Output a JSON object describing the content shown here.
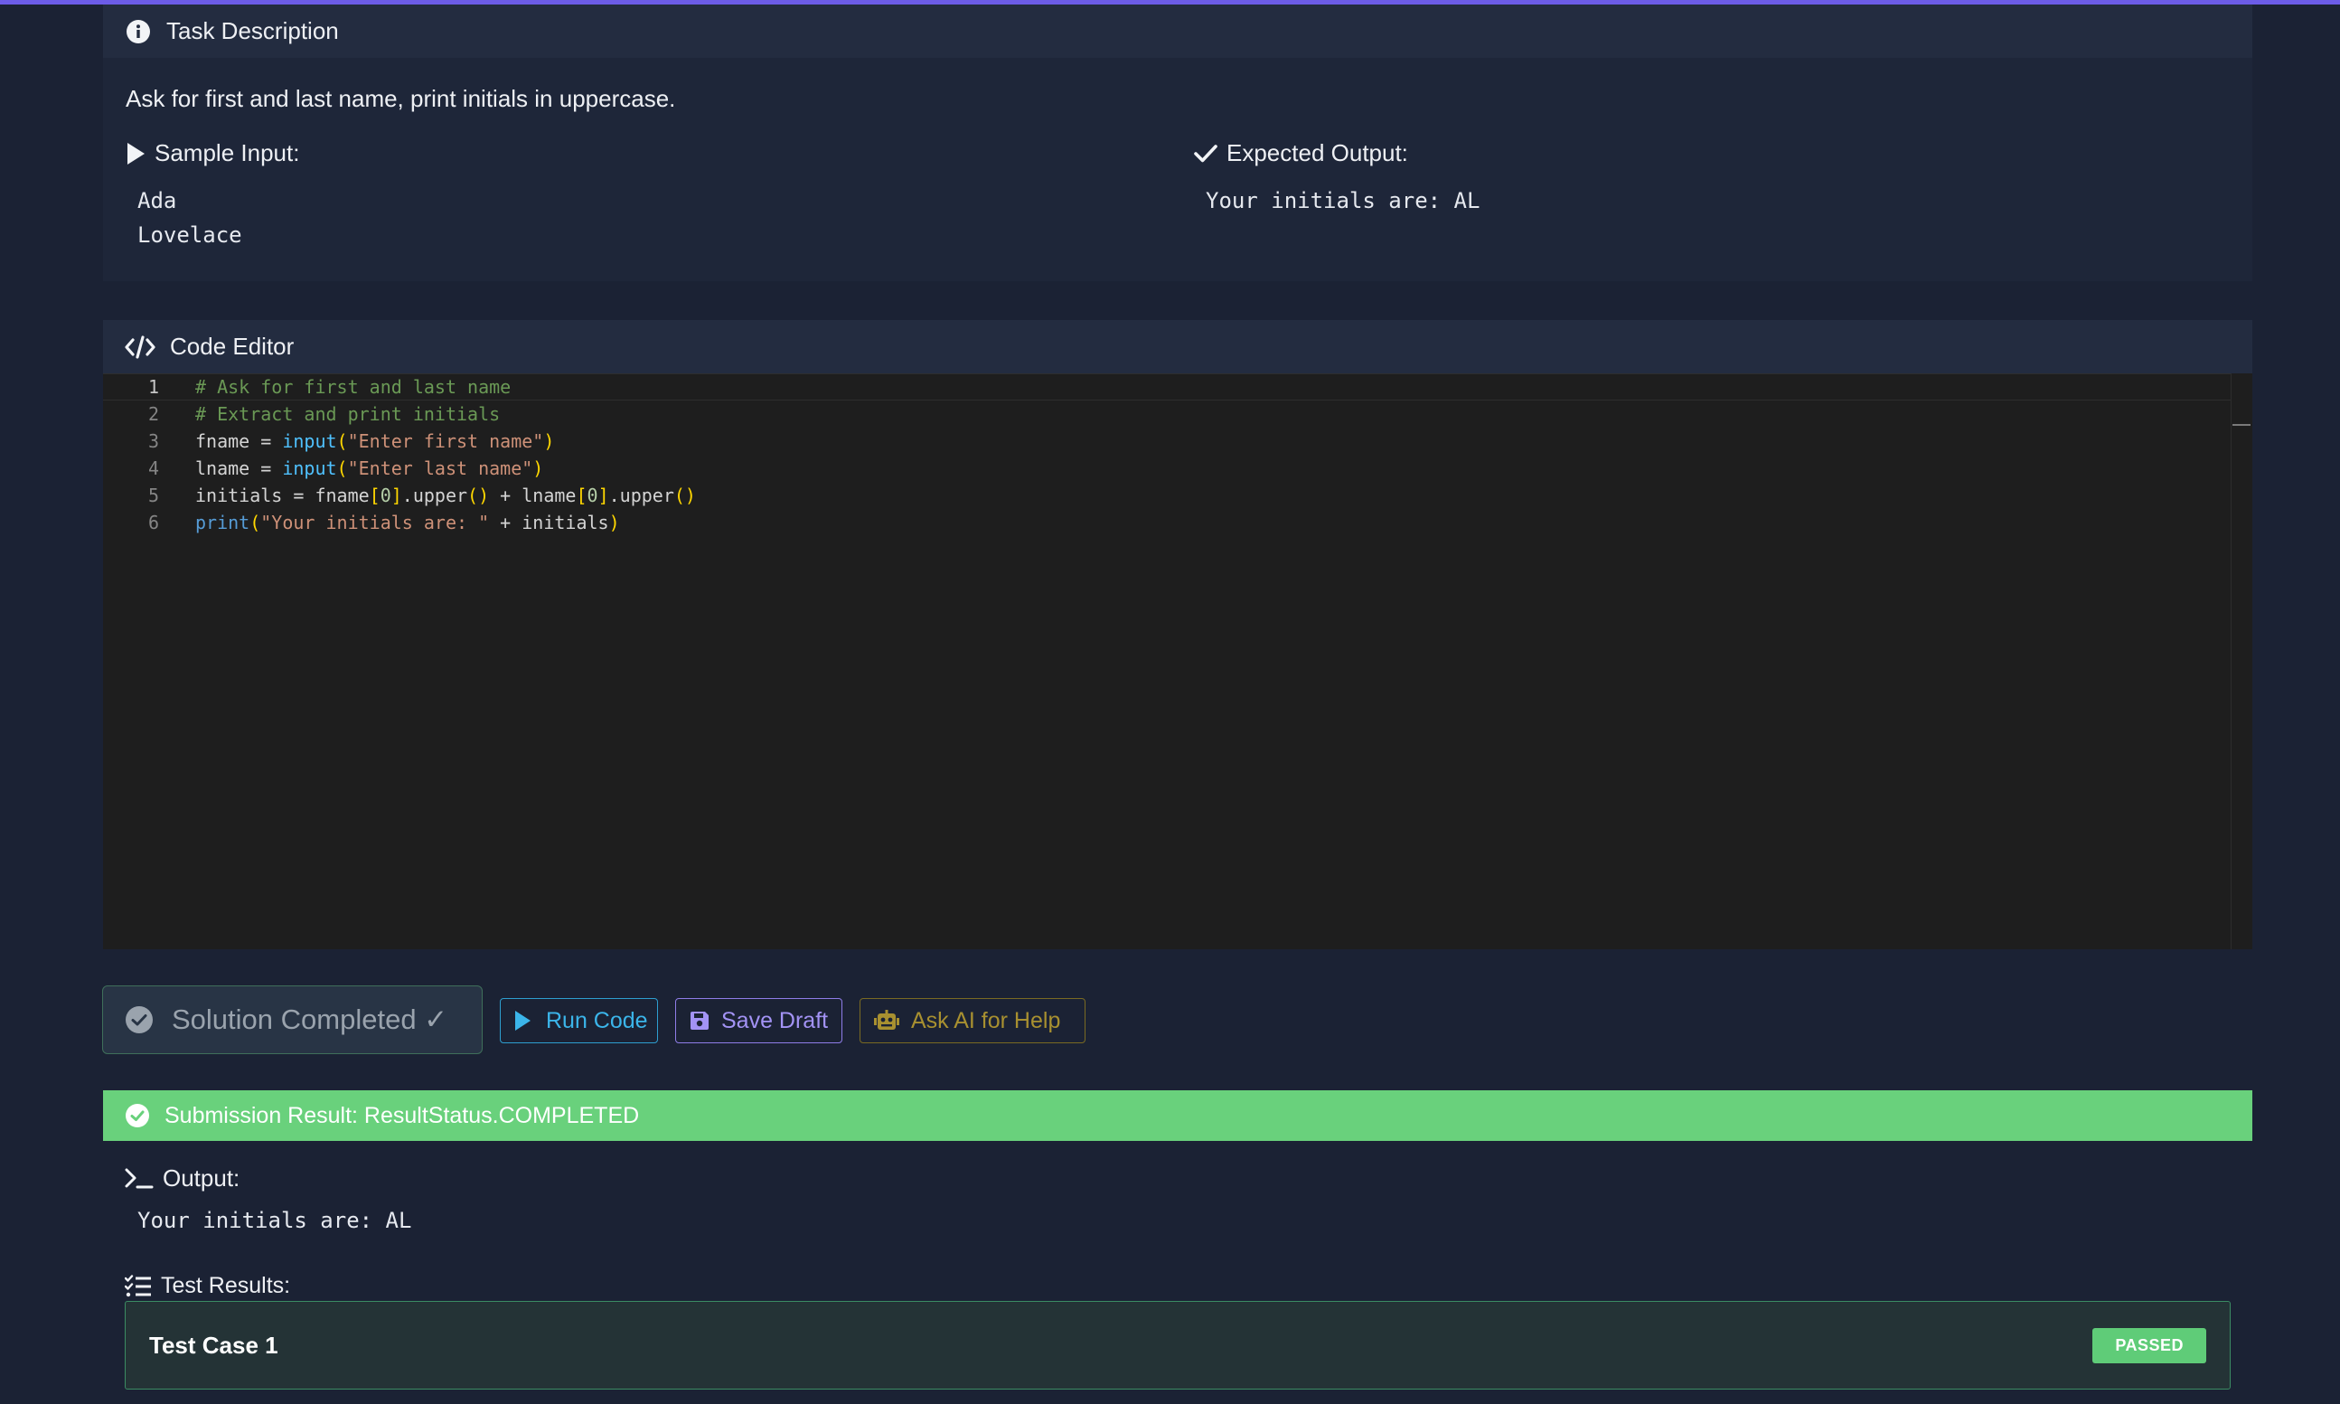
{
  "task": {
    "header_title": "Task Description",
    "description": "Ask for first and last name, print initials in uppercase.",
    "sample_input_label": "Sample Input:",
    "sample_input_lines": [
      "Ada",
      "Lovelace"
    ],
    "expected_output_label": "Expected Output:",
    "expected_output_lines": [
      "Your initials are: AL"
    ]
  },
  "editor": {
    "header_title": "Code Editor",
    "line_numbers": [
      "1",
      "2",
      "3",
      "4",
      "5",
      "6"
    ],
    "lines": [
      "# Ask for first and last name",
      "# Extract and print initials",
      "fname = input(\"Enter first name\")",
      "lname = input(\"Enter last name\")",
      "initials = fname[0].upper() + lname[0].upper()",
      "print(\"Your initials are: \" + initials)"
    ]
  },
  "actions": {
    "completed_label": "Solution Completed ✓",
    "run_label": "Run Code",
    "save_label": "Save Draft",
    "ai_label": "Ask AI for Help"
  },
  "result": {
    "status_text": "Submission Result: ResultStatus.COMPLETED",
    "output_label": "Output:",
    "output_text": "Your initials are: AL",
    "tests_label": "Test Results:",
    "test_cases": [
      {
        "name": "Test Case 1",
        "status": "PASSED"
      }
    ]
  },
  "colors": {
    "accent": "#6c5ce7",
    "success": "#69d17c",
    "run": "#3bb5ea",
    "save": "#a393f5",
    "ai": "#a89030"
  }
}
